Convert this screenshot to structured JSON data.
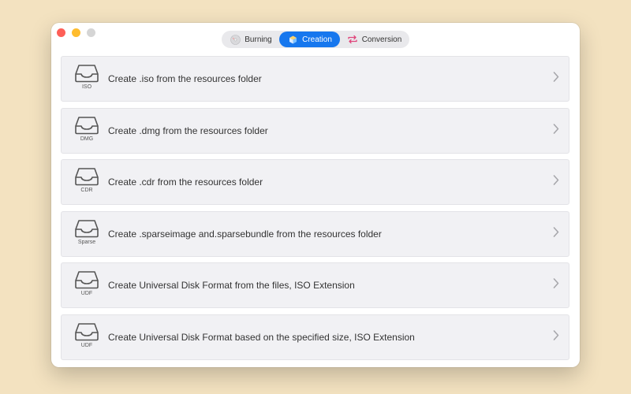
{
  "tabs": [
    {
      "label": "Burning",
      "icon": "disc-burn-icon",
      "selected": false
    },
    {
      "label": "Creation",
      "icon": "cube-icon",
      "selected": true
    },
    {
      "label": "Conversion",
      "icon": "arrows-cycle-icon",
      "selected": false
    }
  ],
  "rows": [
    {
      "title": "Create .iso from the resources folder",
      "caption": "ISO",
      "icon": "drive-tray-icon"
    },
    {
      "title": "Create .dmg from the resources folder",
      "caption": "DMG",
      "icon": "drive-tray-icon"
    },
    {
      "title": "Create .cdr from the resources folder",
      "caption": "CDR",
      "icon": "drive-tray-icon"
    },
    {
      "title": "Create .sparseimage and.sparsebundle from the resources folder",
      "caption": "Sparse",
      "icon": "drive-tray-icon"
    },
    {
      "title": "Create Universal Disk Format from the files, ISO Extension",
      "caption": "UDF",
      "icon": "drive-tray-icon"
    },
    {
      "title": "Create Universal Disk Format based on the specified size, ISO Extension",
      "caption": "UDF",
      "icon": "drive-tray-icon"
    }
  ],
  "colors": {
    "accent": "#1677ee",
    "background": "#f3e2c0",
    "row_bg": "#f1f1f4",
    "conversion_icon": "#e0457b"
  }
}
